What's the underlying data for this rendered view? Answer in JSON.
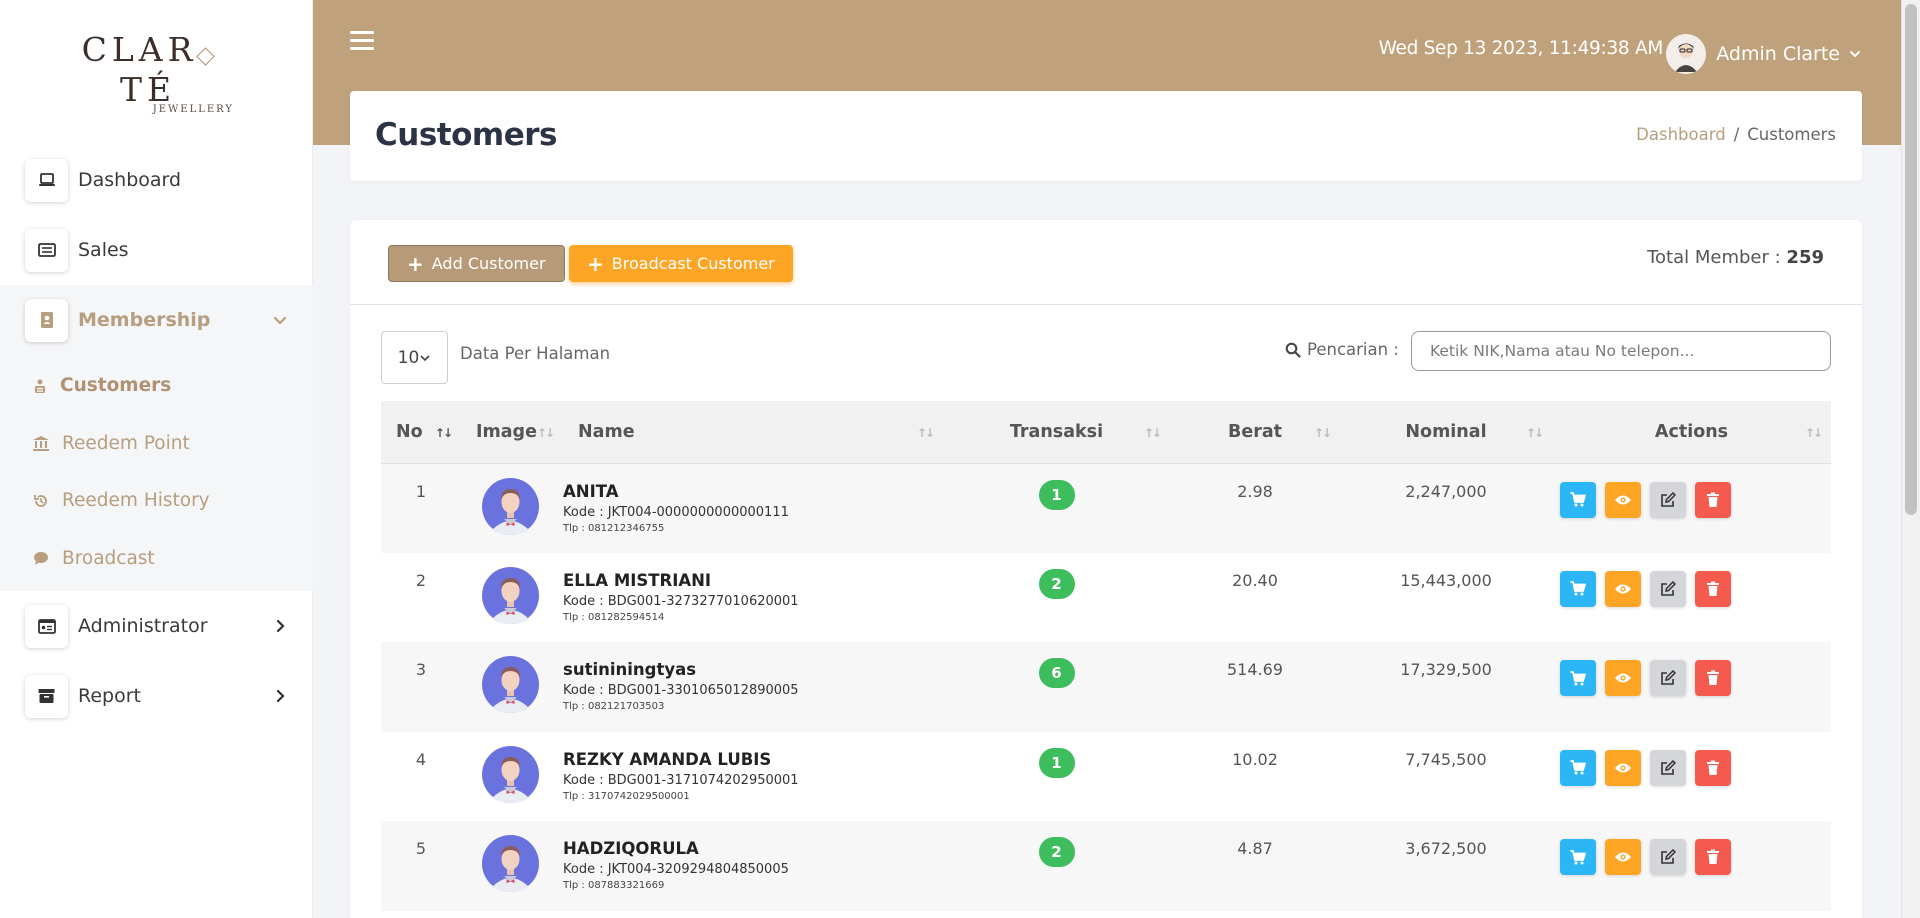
{
  "brand": {
    "name_left": "CLAR",
    "name_right": "TÉ",
    "sub": "JEWELLERY"
  },
  "sidebar": {
    "items": [
      {
        "label": "Dashboard"
      },
      {
        "label": "Sales"
      },
      {
        "label": "Membership"
      },
      {
        "label": "Administrator"
      },
      {
        "label": "Report"
      }
    ],
    "submenu": [
      {
        "label": "Customers"
      },
      {
        "label": "Reedem Point"
      },
      {
        "label": "Reedem History"
      },
      {
        "label": "Broadcast"
      }
    ]
  },
  "header": {
    "datetime": "Wed Sep 13 2023, 11:49:38 AM",
    "user_name": "Admin Clarte"
  },
  "title_card": {
    "title": "Customers",
    "breadcrumb_home": "Dashboard",
    "breadcrumb_sep": "/",
    "breadcrumb_current": "Customers"
  },
  "toolbar": {
    "add_label": "Add Customer",
    "broadcast_label": "Broadcast Customer",
    "total_label": "Total Member : ",
    "total_value": "259"
  },
  "controls": {
    "per_page": "10",
    "per_page_label": "Data Per Halaman",
    "search_label": "Pencarian :",
    "search_placeholder": "Ketik NIK,Nama atau No telepon..."
  },
  "table": {
    "headers": [
      "No",
      "Image",
      "Name",
      "Transaksi",
      "Berat",
      "Nominal",
      "Actions"
    ],
    "rows": [
      {
        "no": "1",
        "name": "ANITA",
        "kode": "Kode : JKT004-0000000000000111",
        "tlp": "Tlp : 081212346755",
        "transaksi": "1",
        "berat": "2.98",
        "nominal": "2,247,000"
      },
      {
        "no": "2",
        "name": "ELLA MISTRIANI",
        "kode": "Kode : BDG001-3273277010620001",
        "tlp": "Tlp : 081282594514",
        "transaksi": "2",
        "berat": "20.40",
        "nominal": "15,443,000"
      },
      {
        "no": "3",
        "name": "sutininingtyas",
        "kode": "Kode : BDG001-3301065012890005",
        "tlp": "Tlp : 082121703503",
        "transaksi": "6",
        "berat": "514.69",
        "nominal": "17,329,500"
      },
      {
        "no": "4",
        "name": "REZKY AMANDA LUBIS",
        "kode": "Kode : BDG001-3171074202950001",
        "tlp": "Tlp : 3170742029500001",
        "transaksi": "1",
        "berat": "10.02",
        "nominal": "7,745,500"
      },
      {
        "no": "5",
        "name": "HADZIQORULA",
        "kode": "Kode : JKT004-3209294804850005",
        "tlp": "Tlp : 087883321669",
        "transaksi": "2",
        "berat": "4.87",
        "nominal": "3,672,500"
      }
    ]
  },
  "colors": {
    "brand_gold": "#bfa27b",
    "accent_text": "#b79e7e",
    "btn_orange": "#ffa526",
    "badge_green": "#3ebd5c",
    "btn_blue": "#2db6f5",
    "btn_red": "#f55a4e"
  },
  "icons": {
    "dashboard": "laptop-icon",
    "sales": "receipt-icon",
    "membership": "address-book-icon",
    "administrator": "id-card-icon",
    "report": "archive-icon",
    "customers": "users-icon",
    "reedem_point": "bank-icon",
    "reedem_history": "history-icon",
    "broadcast": "chat-icon"
  }
}
